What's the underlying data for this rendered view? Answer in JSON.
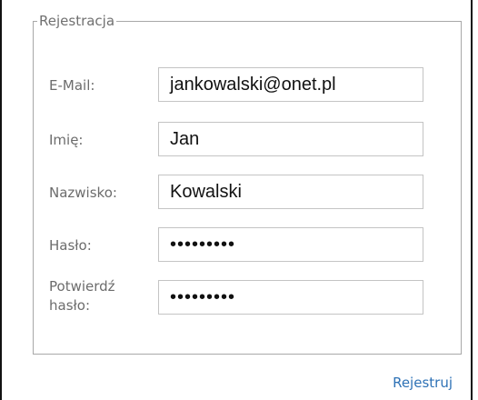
{
  "form": {
    "legend": "Rejestracja",
    "fields": [
      {
        "label": "E-Mail:",
        "value": "jankowalski@onet.pl",
        "type": "text"
      },
      {
        "label": "Imię:",
        "value": "Jan",
        "type": "text"
      },
      {
        "label": "Nazwisko:",
        "value": "Kowalski",
        "type": "text"
      },
      {
        "label": "Hasło:",
        "value": "•••••••••",
        "type": "password"
      },
      {
        "label_line1": "Potwierdź",
        "label_line2": "hasło:",
        "value": "•••••••••",
        "type": "password"
      }
    ],
    "submit_label": "Rejestruj"
  },
  "colors": {
    "border_outer": "#111111",
    "fieldset_border": "#a8a8a8",
    "label_text": "#6c6c6c",
    "input_border": "#c4c4c4",
    "link": "#2e72b6"
  }
}
